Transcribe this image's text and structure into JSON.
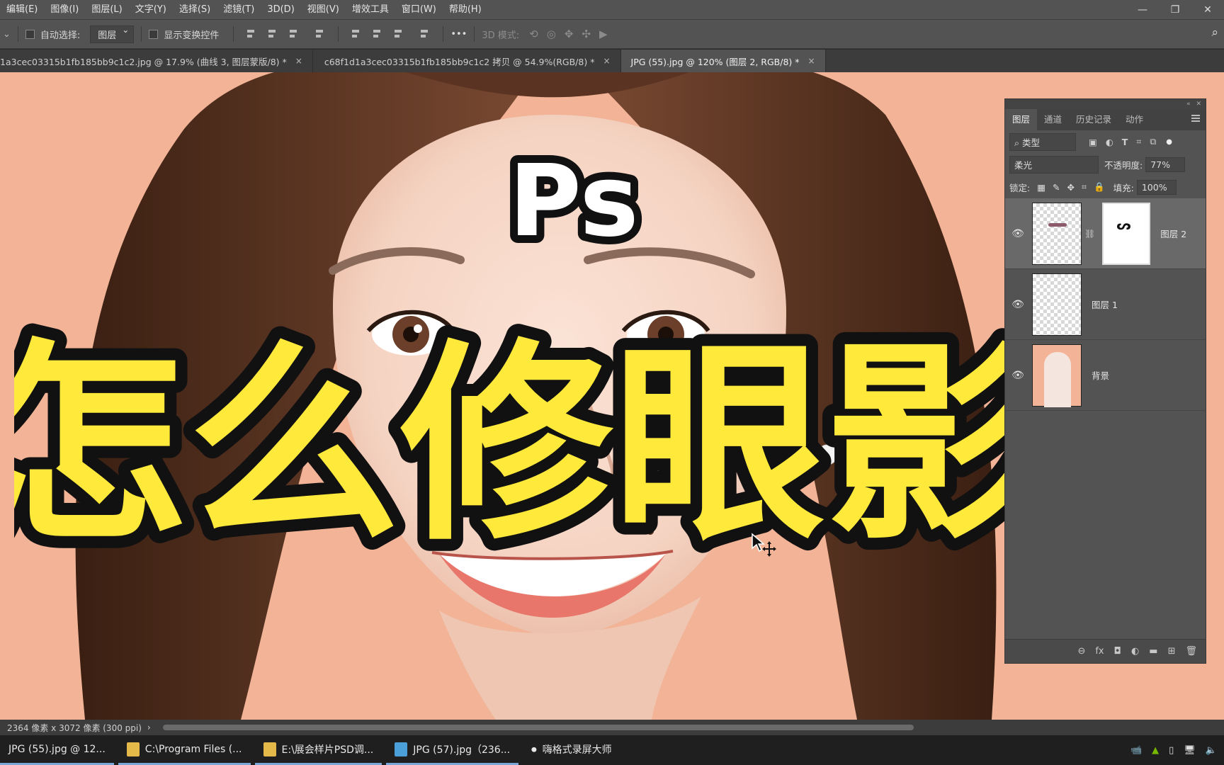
{
  "menu": {
    "items": [
      "编辑(E)",
      "图像(I)",
      "图层(L)",
      "文字(Y)",
      "选择(S)",
      "滤镜(T)",
      "3D(D)",
      "视图(V)",
      "增效工具",
      "窗口(W)",
      "帮助(H)"
    ]
  },
  "options_bar": {
    "auto_select_label": "自动选择:",
    "auto_select_value": "图层",
    "show_transform_label": "显示变换控件",
    "more_label": "•••",
    "mode_3d_label": "3D 模式:"
  },
  "tabs": [
    {
      "label": "1a3cec03315b1fb185bb9c1c2.jpg @ 17.9% (曲线 3, 图层蒙版/8) *",
      "close": "×"
    },
    {
      "label": "c68f1d1a3cec03315b1fb185bb9c1c2 拷贝 @ 54.9%(RGB/8) *",
      "close": "×"
    },
    {
      "label": "JPG (55).jpg @ 120% (图层 2, RGB/8) *",
      "close": "×"
    }
  ],
  "overlay": {
    "ps": "Ps",
    "headline": "怎么修眼影？"
  },
  "layers_panel": {
    "tabs": [
      "图层",
      "通道",
      "历史记录",
      "动作"
    ],
    "filter_label": "类型",
    "blend_mode": "柔光",
    "opacity_label": "不透明度:",
    "opacity_value": "77%",
    "lock_label": "锁定:",
    "fill_label": "填充:",
    "fill_value": "100%",
    "layers": [
      {
        "name": "图层 2",
        "visible": "👁",
        "selected": true
      },
      {
        "name": "图层 1",
        "visible": "👁",
        "selected": false
      },
      {
        "name": "背景",
        "visible": "👁",
        "selected": false
      }
    ],
    "bottom_icons": [
      "⊖",
      "fx",
      "◘",
      "◐",
      "▬",
      "⊞",
      "🗑"
    ]
  },
  "status": {
    "doc_info": "2364 像素 x 3072 像素 (300 ppi)",
    "arrow": "›"
  },
  "taskbar": {
    "items": [
      {
        "label": "JPG (55).jpg @ 12...",
        "color": "#2b5fb0"
      },
      {
        "label": "C:\\Program Files (...",
        "color": "#e5b84a"
      },
      {
        "label": "E:\\展会样片PSD调...",
        "color": "#e5b84a"
      },
      {
        "label": "JPG (57).jpg（236...",
        "color": "#4ba0d9"
      },
      {
        "label": "嗨格式录屏大师",
        "color": "#555"
      }
    ]
  },
  "colors": {
    "headline_fill": "#ffe93a",
    "outline": "#111111",
    "background_peach": "#f2b397"
  }
}
